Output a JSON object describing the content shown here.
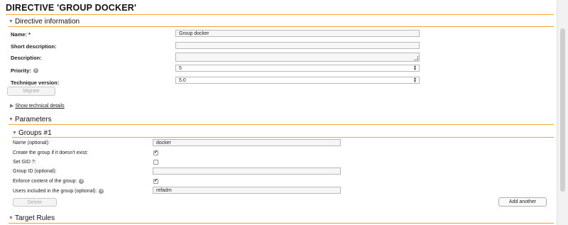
{
  "page": {
    "title": "DIRECTIVE 'GROUP DOCKER'"
  },
  "directive_info": {
    "section_title": "Directive information",
    "name_label": "Name: *",
    "name_value": "Group docker",
    "short_description_label": "Short description:",
    "short_description_value": "",
    "description_label": "Description:",
    "description_value": "",
    "priority_label": "Priority:",
    "priority_value": "5",
    "technique_version_label": "Technique version:",
    "technique_version_value": "5.0",
    "migrate_label": "Migrate",
    "show_technical_details_label": "Show technical details"
  },
  "parameters": {
    "section_title": "Parameters",
    "group_title": "Groups #1",
    "fields": {
      "name_label": "Name (optional):",
      "name_value": "docker",
      "create_group_label": "Create the group if it doesn't exist:",
      "create_group_checked": true,
      "set_gid_label": "Set GID ?:",
      "set_gid_checked": false,
      "group_id_label": "Group ID (optional):",
      "group_id_value": "",
      "enforce_label": "Enforce content of the group:",
      "enforce_checked": true,
      "users_label": "Users included in the group (optional):",
      "users_value": "refadm"
    },
    "delete_label": "Delete",
    "add_another_label": "Add another"
  },
  "target_rules": {
    "section_title": "Target Rules"
  },
  "icons": {
    "expanded": "▼",
    "collapsed": "▶",
    "check": "✔",
    "help": "?",
    "select_up": "▲",
    "select_down": "▼"
  },
  "colors": {
    "accent_rule": "#f0a830"
  }
}
